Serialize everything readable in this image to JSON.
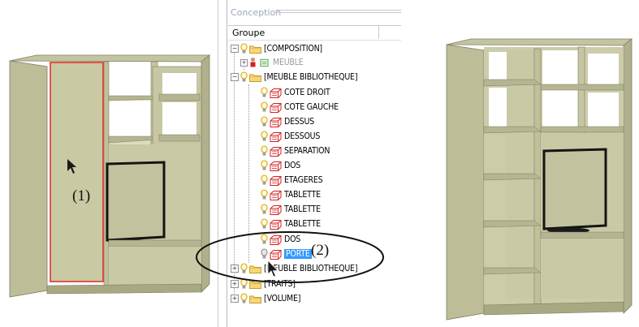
{
  "panel": {
    "section_title": "Conception",
    "column_header": "Groupe"
  },
  "tree": {
    "items": [
      {
        "label": "[COMPOSITION]"
      },
      {
        "label": "MEUBLE"
      },
      {
        "label": "[MEUBLE BIBLIOTHEQUE]"
      },
      {
        "label": "COTE DROIT"
      },
      {
        "label": "COTE GAUCHE"
      },
      {
        "label": "DESSUS"
      },
      {
        "label": "DESSOUS"
      },
      {
        "label": "SEPARATION"
      },
      {
        "label": "DOS"
      },
      {
        "label": "ETAGERES"
      },
      {
        "label": "TABLETTE"
      },
      {
        "label": "TABLETTE"
      },
      {
        "label": "TABLETTE"
      },
      {
        "label": "DOS"
      },
      {
        "label": "PORTE"
      },
      {
        "label": "[MEUBLE BIBLIOTHEQUE]"
      },
      {
        "label": "[TRAITS]"
      },
      {
        "label": "[VOLUME]"
      }
    ],
    "expander_plus": "+",
    "expander_minus": "−"
  },
  "callouts": {
    "left": "(1)",
    "middle": "(2)"
  },
  "colors": {
    "furniture": "#c9c9a3",
    "furniture_dark": "#a8a883",
    "selection_outline": "#e0322b",
    "tree_selection": "#3399ff"
  },
  "icons": [
    "cursor-arrow-icon",
    "bulb-icon",
    "folder-icon",
    "part-icon",
    "tv-icon"
  ]
}
